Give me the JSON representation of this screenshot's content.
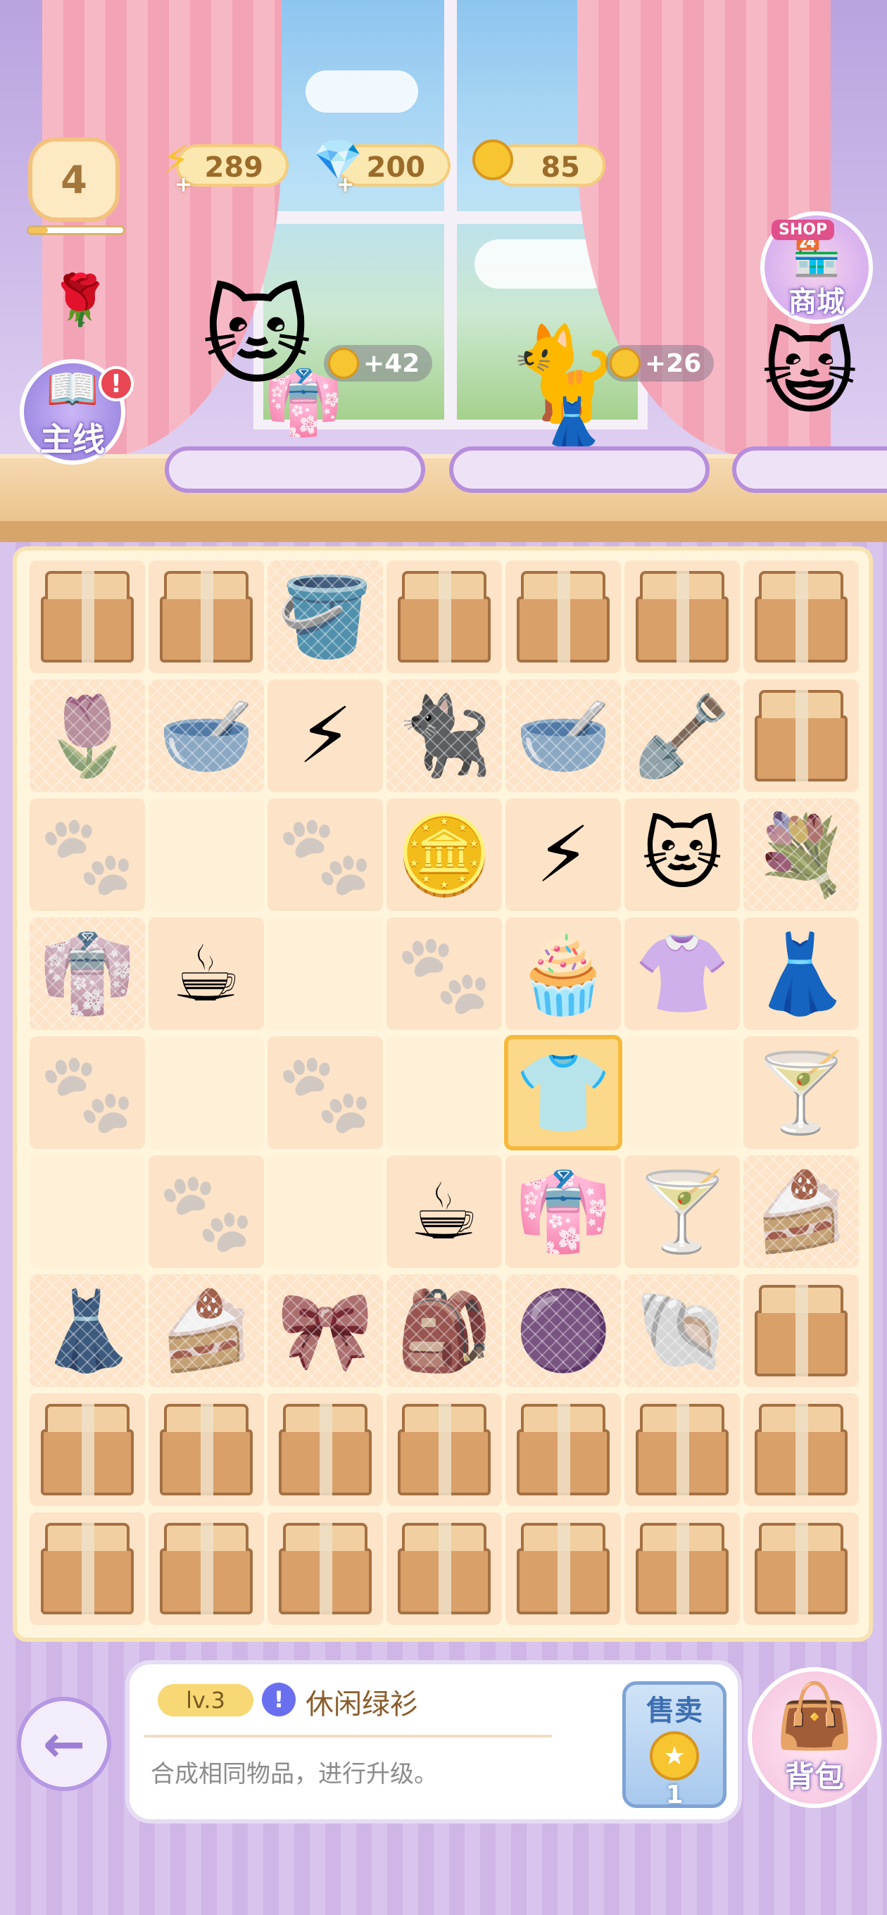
{
  "hud": {
    "level": "4",
    "level_progress": 0.2,
    "energy": "289",
    "gems": "200",
    "coins": "85"
  },
  "buttons": {
    "quest_label": "主线",
    "quest_alert": "!",
    "shop_sign": "SHOP",
    "shop_label": "商城",
    "back_arrow": "←",
    "bag_label": "背包"
  },
  "customers": [
    {
      "reward": "+42",
      "order_icon": "pink-dress-icon"
    },
    {
      "reward": "+26",
      "order_icon": "white-dress-icon"
    }
  ],
  "board": {
    "rows": 9,
    "cols": 7,
    "cells": [
      [
        "box",
        "box",
        "watering-can",
        "box",
        "box",
        "box",
        "box"
      ],
      [
        "tulip",
        "bowl",
        "lightning",
        "cat",
        "teal-bowl",
        "shovel",
        "box"
      ],
      [
        "paw",
        "empty",
        "paw",
        "coins",
        "lightning-double",
        "cat-face",
        "flower-bouquet"
      ],
      [
        "robe",
        "coffee-cup",
        "empty",
        "paw",
        "cupcake",
        "shirt-skirt",
        "pink-dress"
      ],
      [
        "paw",
        "empty",
        "paw",
        "empty",
        "green-sweater",
        "empty",
        "glass"
      ],
      [
        "empty",
        "paw",
        "empty",
        "coffee-machine",
        "pink-clothes",
        "glass",
        "cake"
      ],
      [
        "dress-gray",
        "cake",
        "ribbon",
        "backpack",
        "purple-blob",
        "shell",
        "box"
      ],
      [
        "box",
        "box",
        "box",
        "box",
        "box",
        "box",
        "box"
      ],
      [
        "box",
        "box",
        "box",
        "box",
        "box",
        "box",
        "box"
      ]
    ],
    "selected": {
      "row": 4,
      "col": 4
    }
  },
  "item_info": {
    "level": "lv.3",
    "name": "休闲绿衫",
    "description": "合成相同物品，进行升级。",
    "sell_label": "售卖",
    "sell_price": "1"
  },
  "colors": {
    "board_bg": "#fff5dd",
    "cell_bg": "#fde3c8",
    "selected": "#f6b93d",
    "accent_purple": "#b597e2"
  }
}
